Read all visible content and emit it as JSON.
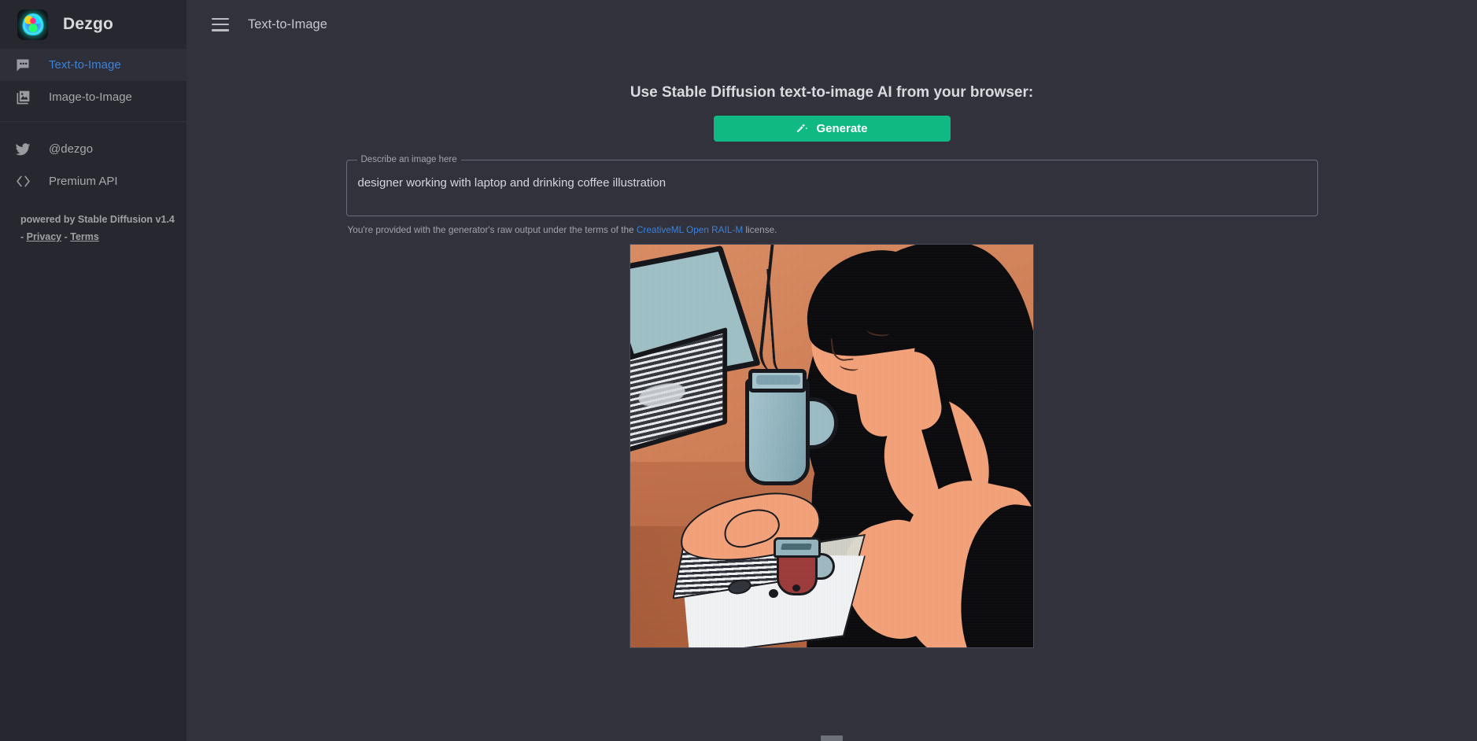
{
  "brand": {
    "name": "Dezgo",
    "logo_icon": "brain-logo-icon"
  },
  "sidebar": {
    "nav": [
      {
        "label": "Text-to-Image",
        "icon": "chat-bubble-dots-icon",
        "active": true
      },
      {
        "label": "Image-to-Image",
        "icon": "photo-stack-icon",
        "active": false
      }
    ],
    "links": [
      {
        "label": "@dezgo",
        "icon": "twitter-bird-icon"
      },
      {
        "label": "Premium API",
        "icon": "code-brackets-icon"
      }
    ],
    "footer": {
      "powered_by": "powered by Stable Diffusion v1.4",
      "legal_prefix": "- ",
      "privacy_label": "Privacy",
      "legal_sep": " - ",
      "terms_label": "Terms"
    }
  },
  "topbar": {
    "menu_icon": "hamburger-menu-icon",
    "title": "Text-to-Image"
  },
  "main": {
    "headline": "Use Stable Diffusion text-to-image AI from your browser:",
    "generate_button": {
      "label": "Generate",
      "icon": "magic-wand-icon",
      "color": "#10b981"
    },
    "prompt_field": {
      "legend": "Describe an image here",
      "value": "designer working with laptop and drinking coffee illustration",
      "placeholder": "Describe an image here"
    },
    "license_notice": {
      "prefix": "You're provided with the generator's raw output under the terms of the ",
      "link_label": "CreativeML Open RAIL-M",
      "suffix": " license.",
      "link_color": "#3b82d9"
    },
    "result_image": {
      "alt": "Illustration of a designer working with a laptop and drinking coffee",
      "width": "514",
      "height": "514"
    }
  },
  "colors": {
    "sidebar_bg": "#272730",
    "main_bg": "#32323d",
    "accent_link": "#3b82d9",
    "accent_green": "#10b981",
    "text_muted": "#a7a8ad"
  }
}
